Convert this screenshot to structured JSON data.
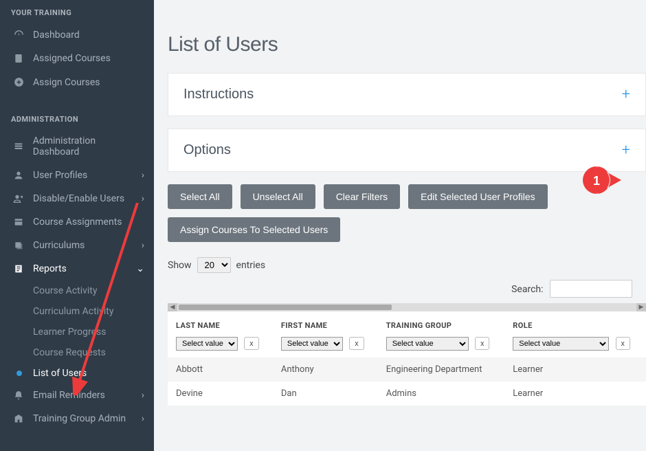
{
  "sidebar": {
    "section1_title": "YOUR TRAINING",
    "section1_items": [
      {
        "label": "Dashboard",
        "icon": "speedometer"
      },
      {
        "label": "Assigned Courses",
        "icon": "clipboard"
      },
      {
        "label": "Assign Courses",
        "icon": "plus-circle"
      }
    ],
    "section2_title": "ADMINISTRATION",
    "section2_items": [
      {
        "label": "Administration Dashboard",
        "icon": "list"
      },
      {
        "label": "User Profiles",
        "icon": "user",
        "chev": "›"
      },
      {
        "label": "Disable/Enable Users",
        "icon": "user-x",
        "chev": "›"
      },
      {
        "label": "Course Assignments",
        "icon": "layers"
      },
      {
        "label": "Curriculums",
        "icon": "stack",
        "chev": "›"
      },
      {
        "label": "Reports",
        "icon": "report",
        "chev": "⌄",
        "expanded": true
      },
      {
        "label": "Email Reminders",
        "icon": "bell",
        "chev": "›"
      },
      {
        "label": "Training Group Admin",
        "icon": "building",
        "chev": "›"
      }
    ],
    "reports_sub": [
      {
        "label": "Course Activity"
      },
      {
        "label": "Curriculum Activity"
      },
      {
        "label": "Learner Progress"
      },
      {
        "label": "Course Requests"
      },
      {
        "label": "List of Users",
        "active": true
      }
    ]
  },
  "page_title": "List of Users",
  "panels": {
    "instructions": "Instructions",
    "options": "Options"
  },
  "toolbar": {
    "select_all": "Select All",
    "unselect_all": "Unselect All",
    "clear_filters": "Clear Filters",
    "edit_selected": "Edit Selected User Profiles",
    "assign_courses": "Assign Courses To Selected Users"
  },
  "entries": {
    "show_label": "Show",
    "value": "20",
    "entries_label": "entries"
  },
  "search_label": "Search:",
  "search_value": "",
  "table": {
    "columns": [
      "LAST NAME",
      "FIRST NAME",
      "TRAINING GROUP",
      "ROLE"
    ],
    "filter_placeholder": "Select value",
    "filter_clear": "x",
    "rows": [
      {
        "last": "Abbott",
        "first": "Anthony",
        "group": "Engineering Department",
        "role": "Learner"
      },
      {
        "last": "Devine",
        "first": "Dan",
        "group": "Admins",
        "role": "Learner"
      }
    ]
  },
  "annotation": {
    "badge_number": "1"
  }
}
